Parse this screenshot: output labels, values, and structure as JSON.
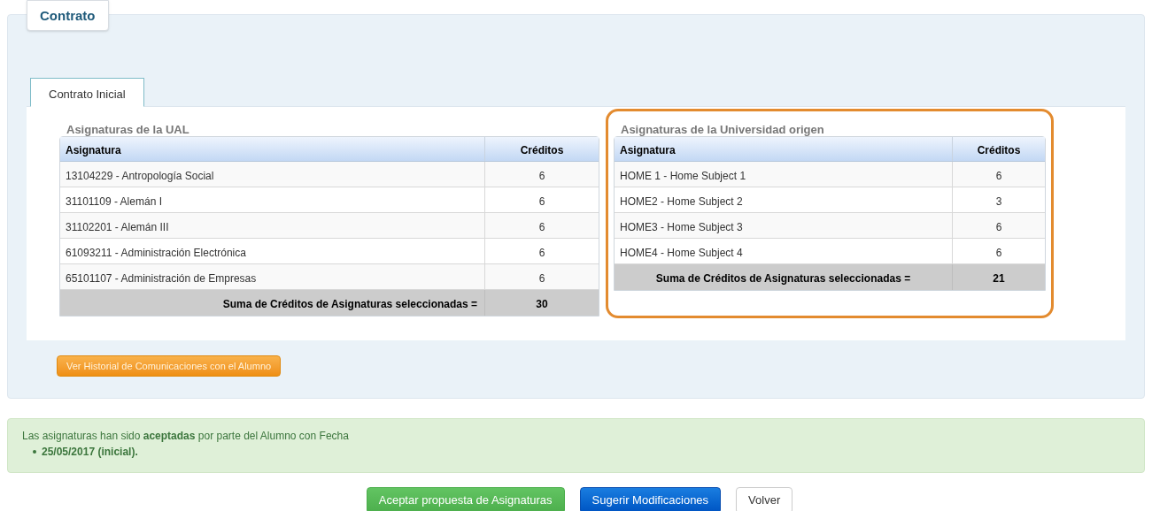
{
  "panel_title": "Contrato",
  "tabs": [
    {
      "label": "Contrato Inicial",
      "selected": true
    }
  ],
  "tables": [
    {
      "title": "Asignaturas de la UAL",
      "highlighted": false,
      "columns": [
        "Asignatura",
        "Créditos"
      ],
      "rows": [
        [
          "13104229 - Antropología Social",
          "6"
        ],
        [
          "31101109 - Alemán I",
          "6"
        ],
        [
          "31102201 - Alemán III",
          "6"
        ],
        [
          "61093211 - Administración Electrónica",
          "6"
        ],
        [
          "65101107 - Administración de Empresas",
          "6"
        ]
      ],
      "total_label": "Suma de Créditos de Asignaturas seleccionadas =",
      "total": "30"
    },
    {
      "title": "Asignaturas de la Universidad origen",
      "highlighted": true,
      "columns": [
        "Asignatura",
        "Créditos"
      ],
      "rows": [
        [
          "HOME 1 - Home Subject 1",
          "6"
        ],
        [
          "HOME2 - Home Subject 2",
          "3"
        ],
        [
          "HOME3 - Home Subject 3",
          "6"
        ],
        [
          "HOME4 - Home Subject 4",
          "6"
        ]
      ],
      "total_label": "Suma de Créditos de Asignaturas seleccionadas =",
      "total": "21"
    }
  ],
  "history_button": "Ver Historial de Comunicaciones con el Alumno",
  "alert": {
    "message": "Las asignaturas han sido **aceptadas** por parte del Alumno con Fecha",
    "dates": [
      "25/05/2017 (inicial)."
    ]
  },
  "actions": [
    {
      "label": "Aceptar propuesta de Asignaturas",
      "kind": "success"
    },
    {
      "label": "Sugerir Modificaciones",
      "kind": "primary"
    },
    {
      "label": "Volver",
      "kind": "default"
    }
  ]
}
